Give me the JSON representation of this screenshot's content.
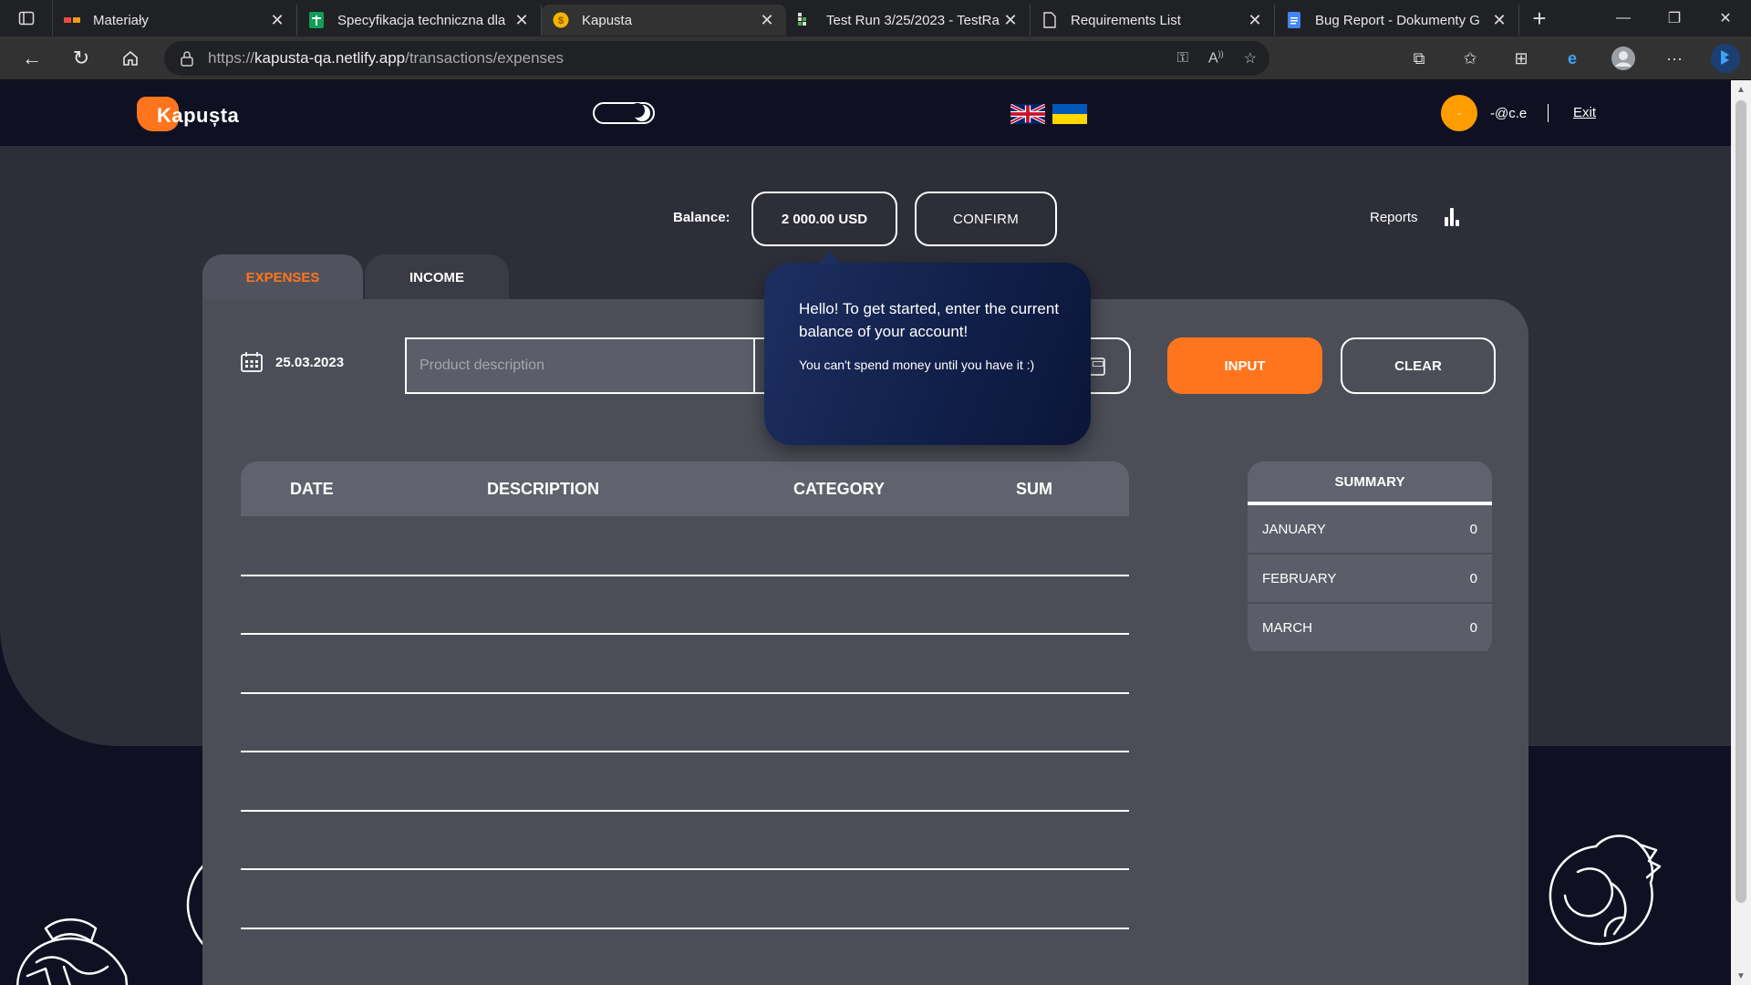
{
  "browser": {
    "tabs": [
      {
        "title": "Materiały",
        "favicon": "materialy-icon",
        "active": false
      },
      {
        "title": "Specyfikacja techniczna dla",
        "favicon": "sheets-icon",
        "active": false
      },
      {
        "title": "Kapusta",
        "favicon": "coin-icon",
        "active": true
      },
      {
        "title": "Test Run 3/25/2023 - TestRa",
        "favicon": "testrail-icon",
        "active": false
      },
      {
        "title": "Requirements List",
        "favicon": "document-icon",
        "active": false
      },
      {
        "title": "Bug Report - Dokumenty G",
        "favicon": "docs-icon",
        "active": false
      }
    ],
    "url_prefix": "https://",
    "url_host": "kapusta-qa.netlify.app",
    "url_path": "/transactions/expenses"
  },
  "header": {
    "logo_text": "Kapușta",
    "avatar_letter": "-",
    "username": "-@c.e",
    "exit_label": "Exit"
  },
  "balance": {
    "label": "Balance:",
    "value": "2 000.00 USD",
    "confirm_label": "CONFIRM"
  },
  "reports": {
    "label": "Reports"
  },
  "tabs": {
    "expenses": "EXPENSES",
    "income": "INCOME"
  },
  "form": {
    "date": "25.03.2023",
    "description_placeholder": "Product description",
    "input_label": "INPUT",
    "clear_label": "CLEAR"
  },
  "tooltip": {
    "message": "Hello! To get started, enter the current balance of your account!",
    "note": "You can't spend money until you have it :)"
  },
  "table": {
    "headers": [
      "DATE",
      "DESCRIPTION",
      "CATEGORY",
      "SUM"
    ],
    "rows": []
  },
  "summary": {
    "title": "SUMMARY",
    "months": [
      {
        "month": "JANUARY",
        "value": "0"
      },
      {
        "month": "FEBRUARY",
        "value": "0"
      },
      {
        "month": "MARCH",
        "value": "0"
      }
    ]
  },
  "colors": {
    "accent": "#ff751d",
    "background": "#0f1123",
    "panel": "#4b4e57",
    "tooltip": "#1d2f61"
  }
}
